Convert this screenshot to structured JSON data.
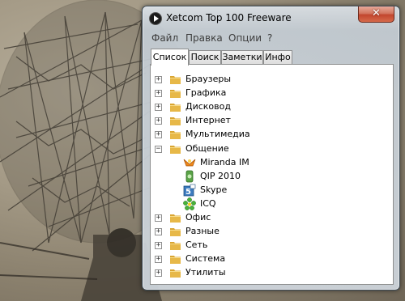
{
  "window": {
    "title": "Xetcom Top 100 Freeware",
    "close_label": "✕"
  },
  "menu": [
    "Файл",
    "Правка",
    "Опции",
    "?"
  ],
  "tabs": [
    "Список",
    "Поиск",
    "Заметки",
    "Инфо"
  ],
  "active_tab": 0,
  "tree": [
    {
      "label": "Браузеры",
      "expanded": false
    },
    {
      "label": "Графика",
      "expanded": false
    },
    {
      "label": "Дисковод",
      "expanded": false
    },
    {
      "label": "Интернет",
      "expanded": false
    },
    {
      "label": "Мультимедиа",
      "expanded": false
    },
    {
      "label": "Общение",
      "expanded": true,
      "children": [
        {
          "label": "Miranda IM",
          "icon": "miranda-icon"
        },
        {
          "label": "QIP 2010",
          "icon": "qip-icon"
        },
        {
          "label": "Skype",
          "icon": "skype-icon"
        },
        {
          "label": "ICQ",
          "icon": "icq-flower-icon"
        }
      ]
    },
    {
      "label": "Офис",
      "expanded": false
    },
    {
      "label": "Разные",
      "expanded": false
    },
    {
      "label": "Сеть",
      "expanded": false
    },
    {
      "label": "Система",
      "expanded": false
    },
    {
      "label": "Утилиты",
      "expanded": false
    }
  ],
  "expander_symbols": {
    "collapsed": "+",
    "expanded": "−"
  },
  "colors": {
    "folder": "#e7b848",
    "close_button": "#c2462e",
    "selection": "#ffffff"
  }
}
